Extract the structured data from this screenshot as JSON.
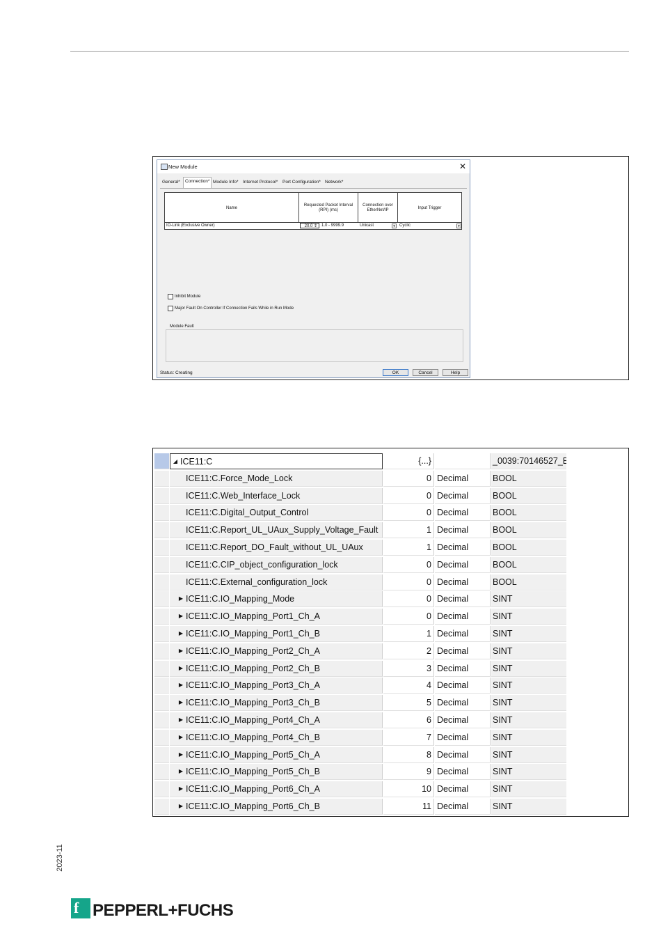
{
  "dialog": {
    "title": "New Module",
    "tabs": [
      "General*",
      "Connection*",
      "Module Info*",
      "Internet Protocol*",
      "Port Configuration*",
      "Network*"
    ],
    "columns": [
      "Name",
      "Requested Packet Interval (RPI) (ms)",
      "Connection over EtherNet/IP",
      "Input Trigger"
    ],
    "row": {
      "name": "IO-Link (Exclusive Owner)",
      "rpi_value": "20.0",
      "rpi_range": "1.0 - 9999.9",
      "connection": "Unicast",
      "trigger": "Cyclic"
    },
    "inhibit_label": "Inhibit Module",
    "major_fault_label": "Major Fault On Controller If Connection Fails While in Run Mode",
    "module_fault_label": "Module Fault",
    "status": "Status: Creating",
    "ok_label": "OK",
    "cancel_label": "Cancel",
    "help_label": "Help"
  },
  "tags": [
    {
      "name": "ICE11:C",
      "value": "{...}",
      "style": "",
      "type": "_0039:70146527_B...",
      "icon": "collapse-arrow",
      "indent": false
    },
    {
      "name": "ICE11:C.Force_Mode_Lock",
      "value": "0",
      "style": "Decimal",
      "type": "BOOL",
      "icon": "",
      "indent": true
    },
    {
      "name": "ICE11:C.Web_Interface_Lock",
      "value": "0",
      "style": "Decimal",
      "type": "BOOL",
      "icon": "",
      "indent": true
    },
    {
      "name": "ICE11:C.Digital_Output_Control",
      "value": "0",
      "style": "Decimal",
      "type": "BOOL",
      "icon": "",
      "indent": true
    },
    {
      "name": "ICE11:C.Report_UL_UAux_Supply_Voltage_Fault",
      "value": "1",
      "style": "Decimal",
      "type": "BOOL",
      "icon": "",
      "indent": true
    },
    {
      "name": "ICE11:C.Report_DO_Fault_without_UL_UAux",
      "value": "1",
      "style": "Decimal",
      "type": "BOOL",
      "icon": "",
      "indent": true
    },
    {
      "name": "ICE11:C.CIP_object_configuration_lock",
      "value": "0",
      "style": "Decimal",
      "type": "BOOL",
      "icon": "",
      "indent": true
    },
    {
      "name": "ICE11:C.External_configuration_lock",
      "value": "0",
      "style": "Decimal",
      "type": "BOOL",
      "icon": "",
      "indent": true
    },
    {
      "name": "ICE11:C.IO_Mapping_Mode",
      "value": "0",
      "style": "Decimal",
      "type": "SINT",
      "icon": "expand-arrow",
      "indent": true
    },
    {
      "name": "ICE11:C.IO_Mapping_Port1_Ch_A",
      "value": "0",
      "style": "Decimal",
      "type": "SINT",
      "icon": "expand-arrow",
      "indent": true
    },
    {
      "name": "ICE11:C.IO_Mapping_Port1_Ch_B",
      "value": "1",
      "style": "Decimal",
      "type": "SINT",
      "icon": "expand-arrow",
      "indent": true
    },
    {
      "name": "ICE11:C.IO_Mapping_Port2_Ch_A",
      "value": "2",
      "style": "Decimal",
      "type": "SINT",
      "icon": "expand-arrow",
      "indent": true
    },
    {
      "name": "ICE11:C.IO_Mapping_Port2_Ch_B",
      "value": "3",
      "style": "Decimal",
      "type": "SINT",
      "icon": "expand-arrow",
      "indent": true
    },
    {
      "name": "ICE11:C.IO_Mapping_Port3_Ch_A",
      "value": "4",
      "style": "Decimal",
      "type": "SINT",
      "icon": "expand-arrow",
      "indent": true
    },
    {
      "name": "ICE11:C.IO_Mapping_Port3_Ch_B",
      "value": "5",
      "style": "Decimal",
      "type": "SINT",
      "icon": "expand-arrow",
      "indent": true
    },
    {
      "name": "ICE11:C.IO_Mapping_Port4_Ch_A",
      "value": "6",
      "style": "Decimal",
      "type": "SINT",
      "icon": "expand-arrow",
      "indent": true
    },
    {
      "name": "ICE11:C.IO_Mapping_Port4_Ch_B",
      "value": "7",
      "style": "Decimal",
      "type": "SINT",
      "icon": "expand-arrow",
      "indent": true
    },
    {
      "name": "ICE11:C.IO_Mapping_Port5_Ch_A",
      "value": "8",
      "style": "Decimal",
      "type": "SINT",
      "icon": "expand-arrow",
      "indent": true
    },
    {
      "name": "ICE11:C.IO_Mapping_Port5_Ch_B",
      "value": "9",
      "style": "Decimal",
      "type": "SINT",
      "icon": "expand-arrow",
      "indent": true
    },
    {
      "name": "ICE11:C.IO_Mapping_Port6_Ch_A",
      "value": "10",
      "style": "Decimal",
      "type": "SINT",
      "icon": "expand-arrow",
      "indent": true
    },
    {
      "name": "ICE11:C.IO_Mapping_Port6_Ch_B",
      "value": "11",
      "style": "Decimal",
      "type": "SINT",
      "icon": "expand-arrow",
      "indent": true
    }
  ],
  "footer": {
    "date": "2023-11",
    "brand": "PEPPERL+FUCHS",
    "brand_color": "#15a58a"
  }
}
